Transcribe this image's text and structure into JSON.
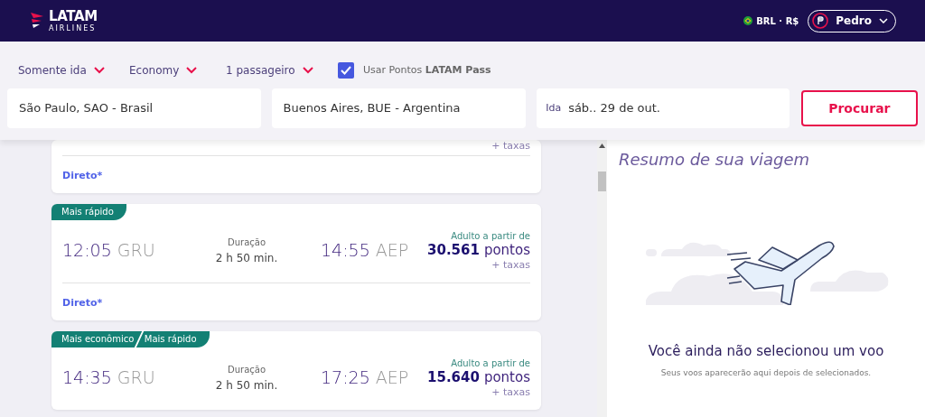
{
  "header": {
    "logo": {
      "name": "LATAM",
      "sub": "AIRLINES"
    },
    "currency": "BRL · R$",
    "user": "Pedro"
  },
  "search": {
    "options": [
      "Somente ida",
      "Economy",
      "1 passageiro"
    ],
    "points_checkbox": {
      "label": "Usar Pontos **LATAM Pass**",
      "checked": true
    },
    "origin": "São Paulo, SAO - Brasil",
    "destination": "Buenos Aires, BUE - Argentina",
    "date": {
      "label": "Ida",
      "value": "sáb.. 29 de out."
    },
    "button": "Procurar"
  },
  "flights": [
    {
      "taxes": "+ taxas",
      "stops": "Direto*"
    },
    {
      "tags": [
        "Mais rápido"
      ],
      "departure_time": "12:05",
      "departure_airport": "GRU",
      "duration_label": "Duração",
      "duration": "2 h 50 min.",
      "arrival_time": "14:55",
      "arrival_airport": "AEP",
      "price_label": "Adulto a partir de",
      "points": "30.561",
      "points_unit": "pontos",
      "taxes": "+ taxas",
      "stops": "Direto*"
    },
    {
      "tags": [
        "Mais econômico",
        "Mais rápido"
      ],
      "departure_time": "14:35",
      "departure_airport": "GRU",
      "duration_label": "Duração",
      "duration": "2 h 50 min.",
      "arrival_time": "17:25",
      "arrival_airport": "AEP",
      "price_label": "Adulto a partir de",
      "points": "15.640",
      "points_unit": "pontos",
      "taxes": "+ taxas"
    }
  ],
  "summary": {
    "title": "Resumo de sua viagem",
    "message": "Você ainda não selecionou um voo",
    "hint": "Seus voos aparecerão aqui depois de selecionados."
  }
}
